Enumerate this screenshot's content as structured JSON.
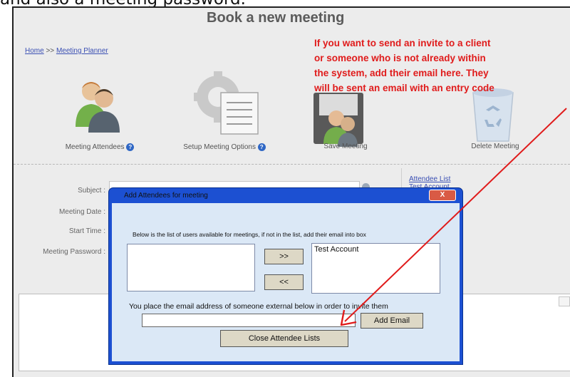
{
  "caption": "and also a meeting password.",
  "page": {
    "title": "Book a new meeting",
    "breadcrumb": {
      "home": "Home",
      "sep": ">>",
      "current": "Meeting Planner"
    }
  },
  "annotation": {
    "lines": [
      "If you want to send an invite to a client",
      "or someone who is not already within",
      "the system, add their email here. They",
      "will be sent an email with an entry code"
    ],
    "color": "#e01b1b"
  },
  "toolbar": {
    "attendees": "Meeting Attendees",
    "options": "Setup Meeting Options",
    "save": "Save Meeting",
    "delete": "Delete Meeting"
  },
  "form": {
    "subject": "Subject :",
    "date": "Meeting Date :",
    "start": "Start Time :",
    "password": "Meeting Password :"
  },
  "side_links": {
    "attendee_list": "Attendee List",
    "test_account": "Test Account"
  },
  "dialog": {
    "title": "Add Attendees for meeting",
    "close": "X",
    "instruction": "Below is the list of users available for meetings, if not in the list, add their email into box",
    "available_users": [],
    "selected_users": [
      "Test Account"
    ],
    "add_btn": ">>",
    "remove_btn": "<<",
    "external_label": "You place the email address of someone external below in order to invite them",
    "email_value": "",
    "add_email_btn": "Add Email",
    "close_lists_btn": "Close Attendee Lists"
  }
}
